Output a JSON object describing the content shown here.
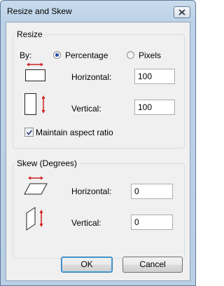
{
  "window": {
    "title": "Resize and Skew"
  },
  "resize": {
    "legend": "Resize",
    "by_label": "By:",
    "percentage_label": "Percentage",
    "pixels_label": "Pixels",
    "selected": "Percentage",
    "horizontal_label": "Horizontal:",
    "horizontal_value": "100",
    "vertical_label": "Vertical:",
    "vertical_value": "100",
    "maintain_aspect_label": "Maintain aspect ratio",
    "maintain_aspect_checked": true
  },
  "skew": {
    "legend": "Skew (Degrees)",
    "horizontal_label": "Horizontal:",
    "horizontal_value": "0",
    "vertical_label": "Vertical:",
    "vertical_value": "0"
  },
  "buttons": {
    "ok": "OK",
    "cancel": "Cancel"
  },
  "colors": {
    "arrow": "#d11f1f",
    "accent": "#1f4ea5"
  }
}
